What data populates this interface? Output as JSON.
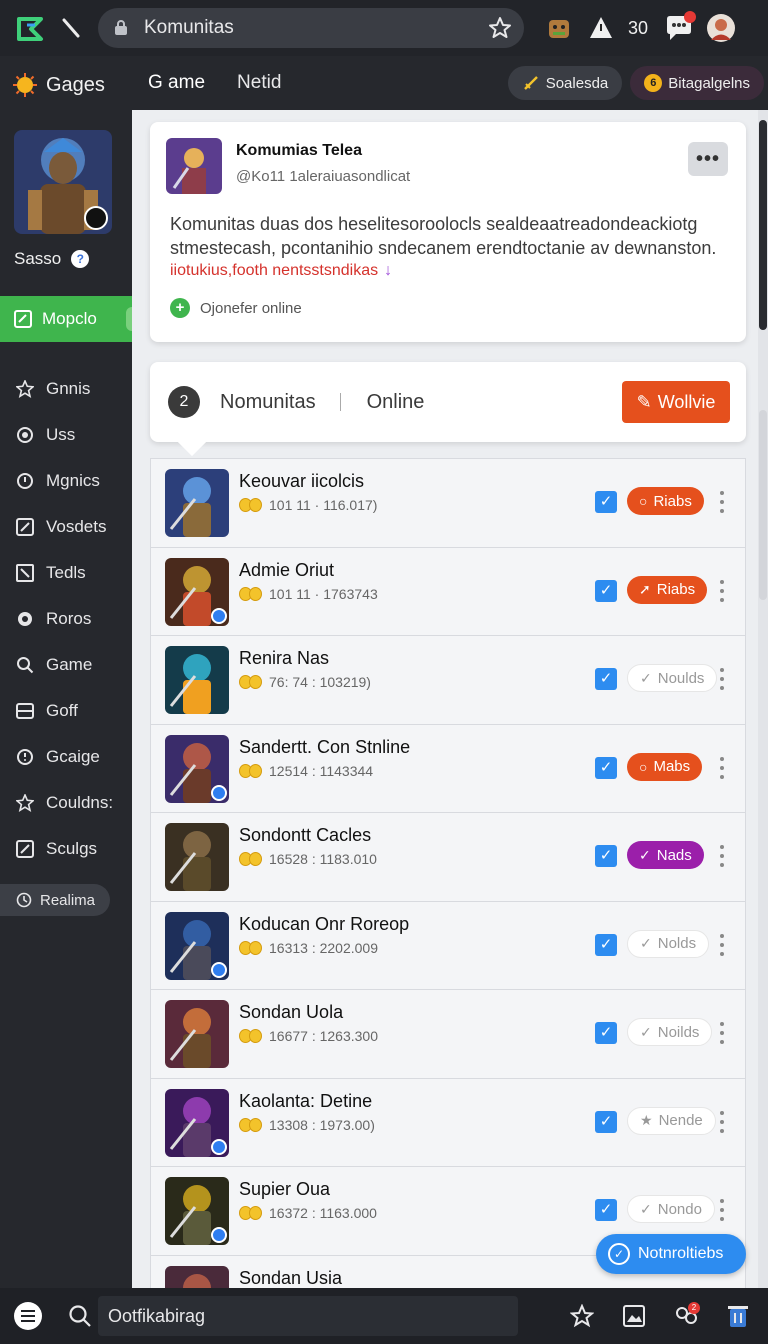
{
  "browser": {
    "url_text": "Komunitas",
    "count": "30"
  },
  "sidebar": {
    "brand": "Gages",
    "username": "Sasso",
    "help": "?",
    "active_item": "Mopclo",
    "items": [
      {
        "label": "Gnnis",
        "icon": "star-icon"
      },
      {
        "label": "Uss",
        "icon": "dot-icon"
      },
      {
        "label": "Mgnics",
        "icon": "ring-icon"
      },
      {
        "label": "Vosdets",
        "icon": "edit-icon"
      },
      {
        "label": "Tedls",
        "icon": "square-icon"
      },
      {
        "label": "Roros",
        "icon": "target-icon"
      },
      {
        "label": "Game",
        "icon": "search-icon"
      },
      {
        "label": "Goff",
        "icon": "list-icon"
      },
      {
        "label": "Gcaige",
        "icon": "clock-icon"
      },
      {
        "label": "Couldns:",
        "icon": "star-icon"
      },
      {
        "label": "Sculgs",
        "icon": "edit-icon"
      }
    ],
    "pill": "Realima"
  },
  "header": {
    "tabs": [
      {
        "label": "G ame"
      },
      {
        "label": "Netid"
      }
    ],
    "chip1": "Soalesda",
    "chip2_badge": "6",
    "chip2": "Bitagalgelns"
  },
  "post": {
    "title": "Komumias Telea",
    "handle": "@Ko11 1aleraiuasondlicat",
    "more": "•••",
    "description": "Komunitas duas dos heselitesoroolocls sealdeaatreadondeackiotg stmestecash, pcontanihio sndecanem erendtoctanie av dewnanston.",
    "link": "iiotukius,footh nentsstsndikas",
    "link_arrow": "↓",
    "status": "Ojonefer online"
  },
  "tabsbar": {
    "number": "2",
    "tab1": "Nomunitas",
    "tab2": "Online",
    "button": "Wollvie"
  },
  "games": [
    {
      "name": "Keouvar iicolcis",
      "meta": "101 11 · 116.017)",
      "pill": "Riabs",
      "pill_style": "orange",
      "pill_icon": "○"
    },
    {
      "name": "Admie Oriut",
      "meta": "101 11 · 1763743",
      "pill": "Riabs",
      "pill_style": "orange",
      "pill_icon": "➚"
    },
    {
      "name": "Renira Nas",
      "meta": "76: 74 : 103219)",
      "pill": "Noulds",
      "pill_style": "white",
      "pill_icon": "✓"
    },
    {
      "name": "Sandertt. Con Stnline",
      "meta": "12514 : 1143344",
      "pill": "Mabs",
      "pill_style": "orange",
      "pill_icon": "○"
    },
    {
      "name": "Sondontt Cacles",
      "meta": "16528 : 1183.010",
      "pill": "Nads",
      "pill_style": "purple",
      "pill_icon": "✓"
    },
    {
      "name": "Koducan Onr Roreop",
      "meta": "16313 : 2202.009",
      "pill": "Nolds",
      "pill_style": "white",
      "pill_icon": "✓"
    },
    {
      "name": "Sondan Uola",
      "meta": "16677 : 1263.300",
      "pill": "Noilds",
      "pill_style": "white",
      "pill_icon": "✓"
    },
    {
      "name": "Kaolanta: Detine",
      "meta": "13308 : 1973.00)",
      "pill": "Nende",
      "pill_style": "white",
      "pill_icon": "★"
    },
    {
      "name": "Supier Oua",
      "meta": "16372 : 1163.000",
      "pill": "Nondo",
      "pill_style": "white",
      "pill_icon": "✓"
    },
    {
      "name": "Sondan Usia",
      "meta": "",
      "pill": "",
      "pill_style": "white",
      "pill_icon": ""
    }
  ],
  "toast": "Notnroltiebs",
  "bottom": {
    "search_text": "Ootfikabirag",
    "badge": "2"
  },
  "colors": {
    "accent_green": "#3fb54d",
    "accent_orange": "#e5501d",
    "accent_blue": "#2d8cf0",
    "accent_purple": "#9b1faa"
  }
}
